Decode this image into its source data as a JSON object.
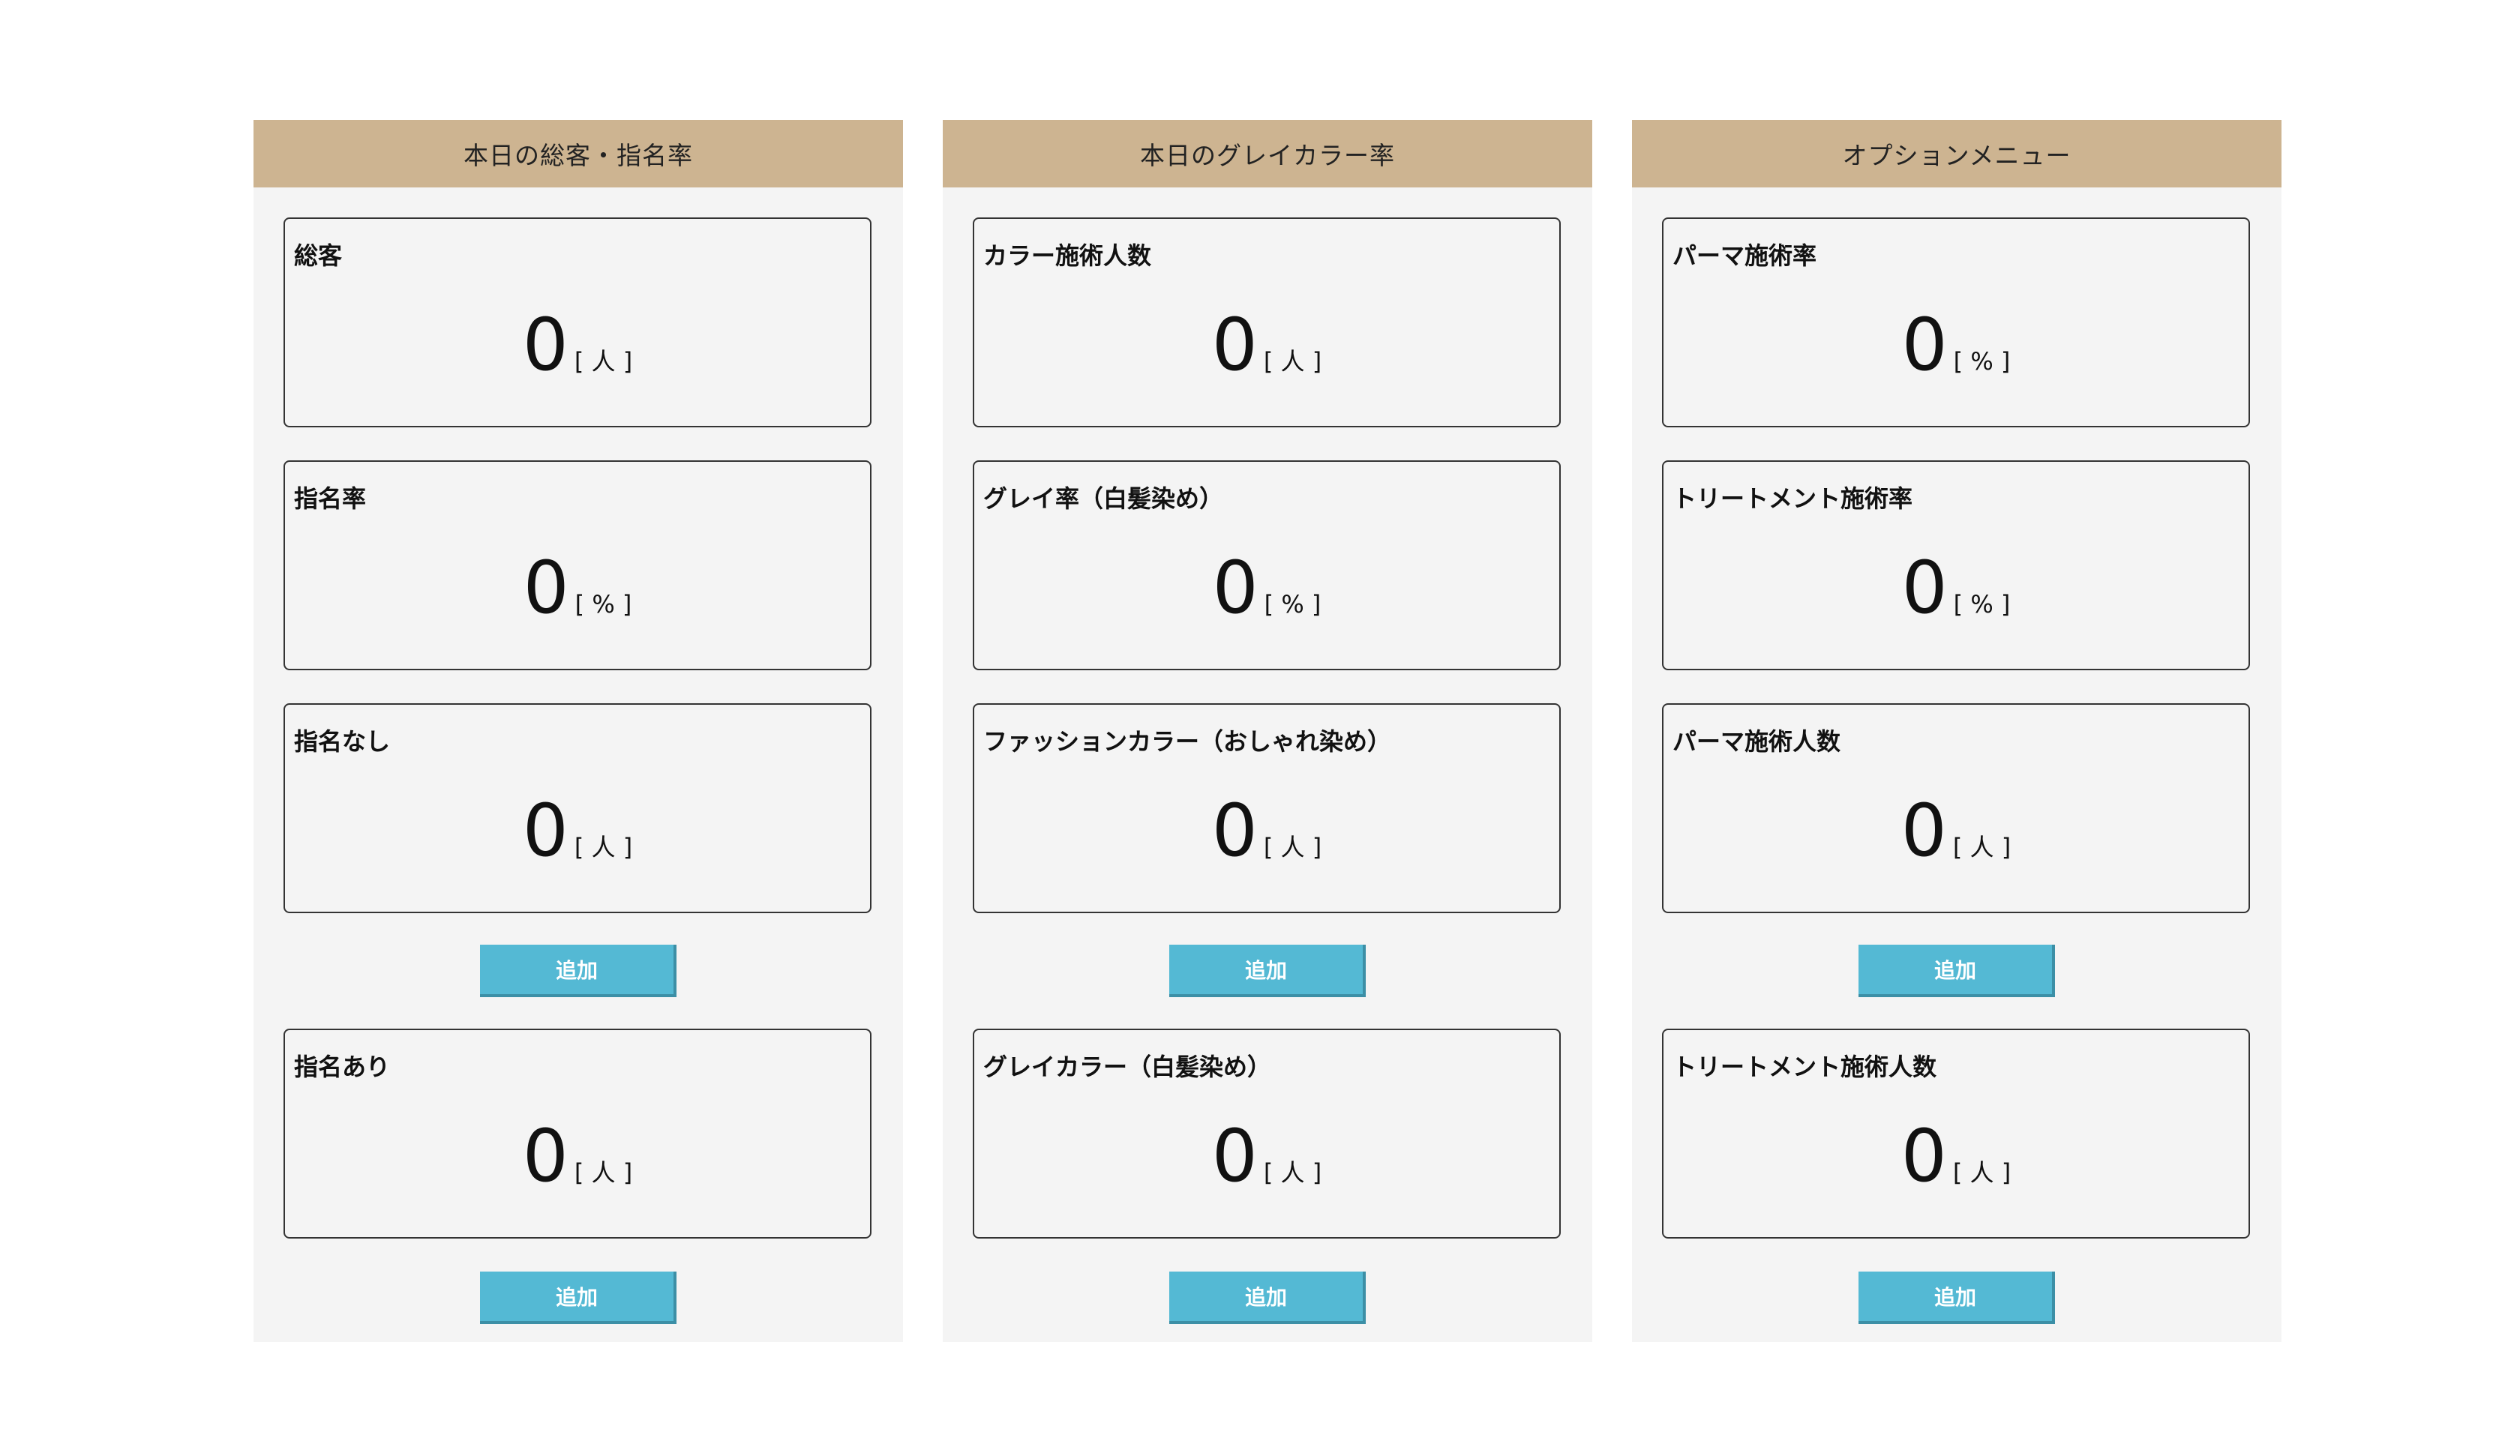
{
  "panels": [
    {
      "title": "本日の総客・指名率",
      "cards": [
        {
          "label": "総客",
          "value": "0",
          "unit": "[ 人 ]"
        },
        {
          "label": "指名率",
          "value": "0",
          "unit": "[ % ]"
        },
        {
          "label": "指名なし",
          "value": "0",
          "unit": "[ 人 ]"
        },
        {
          "label": "指名あり",
          "value": "0",
          "unit": "[ 人 ]"
        }
      ],
      "buttons": [
        "追加",
        "追加"
      ]
    },
    {
      "title": "本日のグレイカラー率",
      "cards": [
        {
          "label": "カラー施術人数",
          "value": "0",
          "unit": "[ 人 ]"
        },
        {
          "label": "グレイ率（白髪染め）",
          "value": "0",
          "unit": "[ % ]"
        },
        {
          "label": "ファッションカラー（おしゃれ染め）",
          "value": "0",
          "unit": "[ 人 ]"
        },
        {
          "label": "グレイカラー（白髪染め）",
          "value": "0",
          "unit": "[ 人 ]"
        }
      ],
      "buttons": [
        "追加",
        "追加"
      ]
    },
    {
      "title": "オプションメニュー",
      "cards": [
        {
          "label": "パーマ施術率",
          "value": "0",
          "unit": "[ % ]"
        },
        {
          "label": "トリートメント施術率",
          "value": "0",
          "unit": "[ % ]"
        },
        {
          "label": "パーマ施術人数",
          "value": "0",
          "unit": "[ 人 ]"
        },
        {
          "label": "トリートメント施術人数",
          "value": "0",
          "unit": "[ 人 ]"
        }
      ],
      "buttons": [
        "追加",
        "追加"
      ]
    }
  ],
  "colors": {
    "header_bg": "#cdb491",
    "panel_bg": "#f4f4f4",
    "button_bg": "#54b9d4"
  }
}
